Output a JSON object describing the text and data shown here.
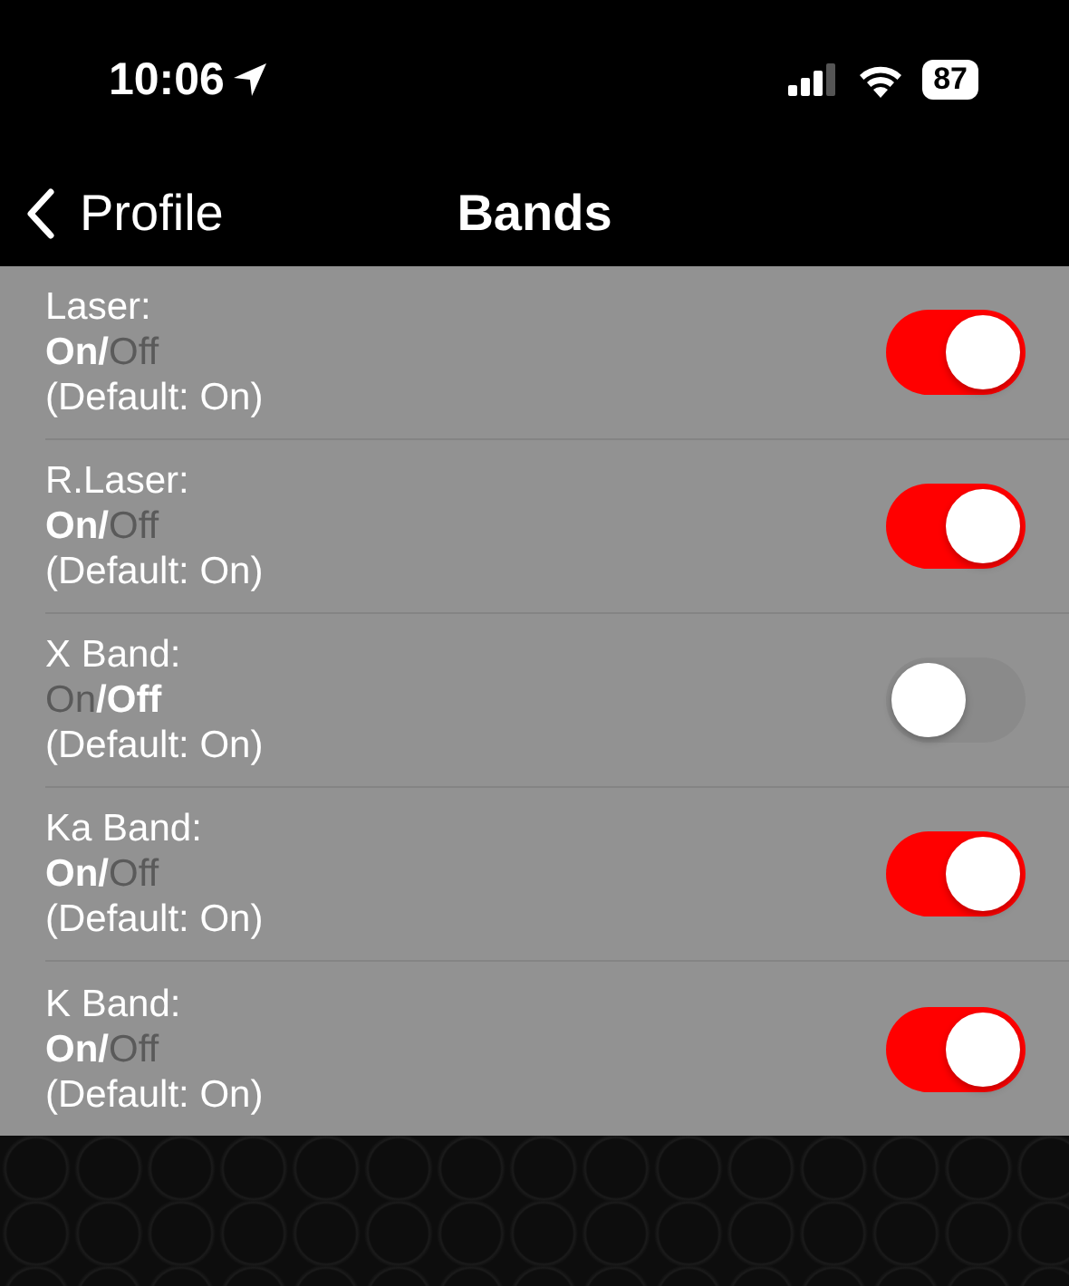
{
  "status_bar": {
    "time": "10:06",
    "battery": "87"
  },
  "nav": {
    "back": "Profile",
    "title": "Bands"
  },
  "bands": [
    {
      "label": "Laser:",
      "on_text": "On",
      "separator": "/",
      "off_text": "Off",
      "default": "(Default: On)",
      "on": true
    },
    {
      "label": "R.Laser:",
      "on_text": "On",
      "separator": "/",
      "off_text": "Off",
      "default": "(Default: On)",
      "on": true
    },
    {
      "label": "X Band:",
      "on_text": "On",
      "separator": "/",
      "off_text": "Off",
      "default": "(Default: On)",
      "on": false
    },
    {
      "label": "Ka Band:",
      "on_text": "On",
      "separator": "/",
      "off_text": "Off",
      "default": "(Default: On)",
      "on": true
    },
    {
      "label": "K Band:",
      "on_text": "On",
      "separator": "/",
      "off_text": "Off",
      "default": "(Default: On)",
      "on": true
    }
  ]
}
